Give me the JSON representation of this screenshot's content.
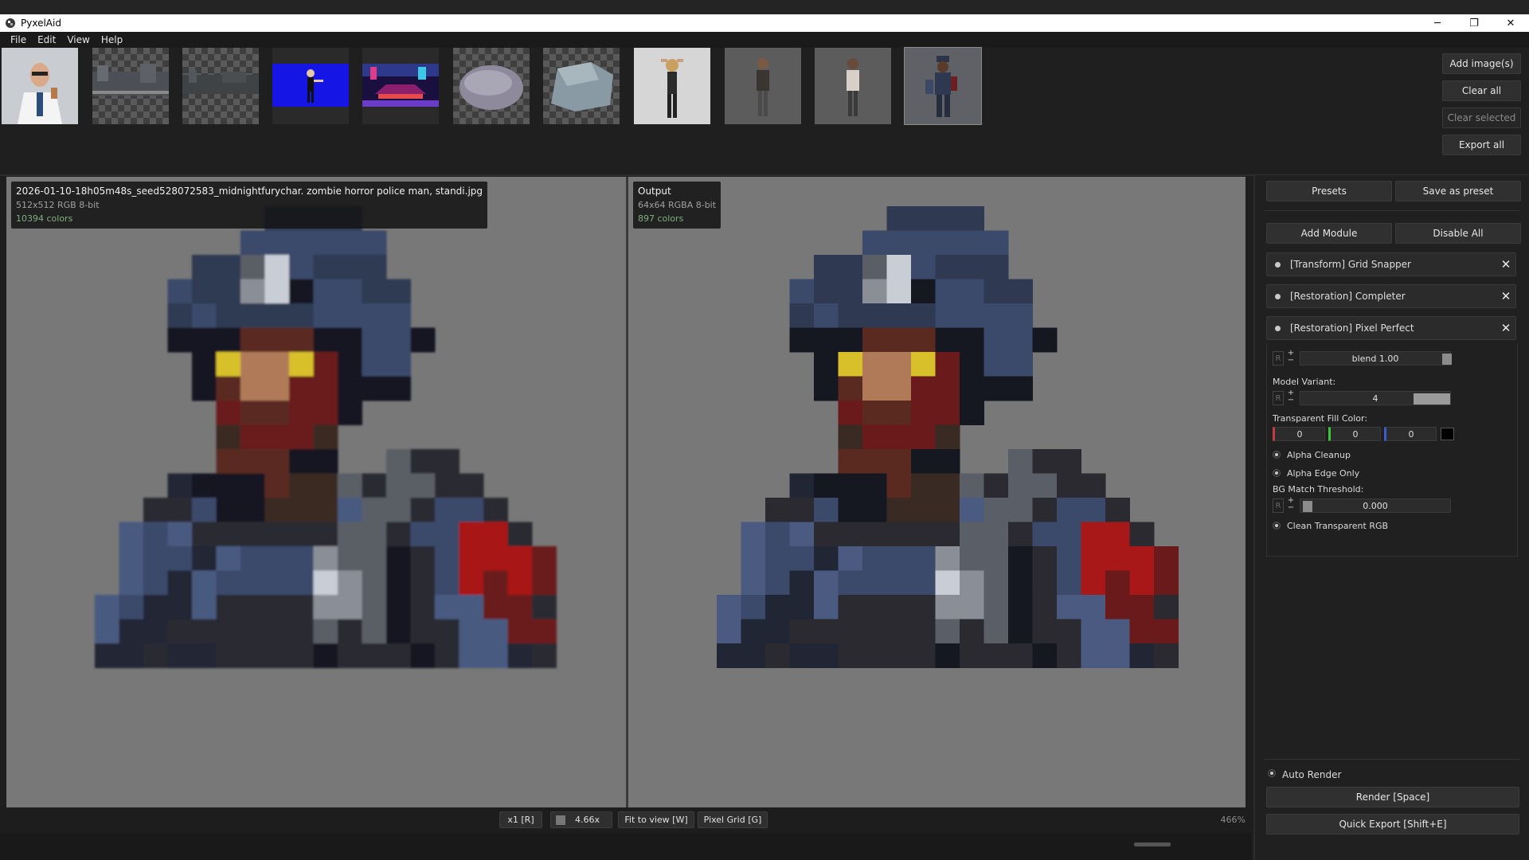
{
  "window": {
    "title": "PyxelAid",
    "controls": [
      "─",
      "❐",
      "✕"
    ]
  },
  "menu": [
    "File",
    "Edit",
    "View",
    "Help"
  ],
  "toolbar_buttons": {
    "add_images": "Add image(s)",
    "clear_all": "Clear all",
    "clear_selected": "Clear selected",
    "export_all": "Export all"
  },
  "input_view": {
    "filename": "2026-01-10-18h05m48s_seed528072583_midnightfurychar. zombie horror police man, standi.jpg",
    "meta": "512x512  RGB  8-bit",
    "colors": "10394 colors"
  },
  "output_view": {
    "label": "Output",
    "meta": "64x64  RGBA  8-bit",
    "colors": "897 colors"
  },
  "bottom_bar": {
    "scale": "x1 [R]",
    "zoom_value": "4.66x",
    "fit": "Fit to view [W]",
    "pixel_grid": "Pixel Grid [G]",
    "zoom_pct": "466%"
  },
  "right_panel": {
    "presets": "Presets",
    "save_preset": "Save as preset",
    "add_module": "Add Module",
    "disable_all": "Disable All",
    "modules": [
      "[Transform] Grid Snapper",
      "[Restoration] Completer",
      "[Restoration] Pixel Perfect"
    ],
    "blend": "blend 1.00",
    "model_variant_label": "Model Variant:",
    "model_variant_value": "4",
    "fill_color_label": "Transparent Fill Color:",
    "fill_r": "0",
    "fill_g": "0",
    "fill_b": "0",
    "alpha_cleanup": "Alpha Cleanup",
    "alpha_edge_only": "Alpha Edge Only",
    "bg_match_label": "BG Match Threshold:",
    "bg_match_value": "0.000",
    "clean_rgb": "Clean Transparent RGB",
    "auto_render": "Auto Render",
    "render": "Render  [Space]",
    "quick_export": "Quick Export  [Shift+E]",
    "r_flag": "R"
  },
  "colors": {
    "accent_red": "#c43c3c",
    "accent_green": "#3cc43c",
    "accent_blue": "#3c5ccc",
    "eye_yellow": "#d8c02a",
    "viewer_bg": "#787878"
  }
}
